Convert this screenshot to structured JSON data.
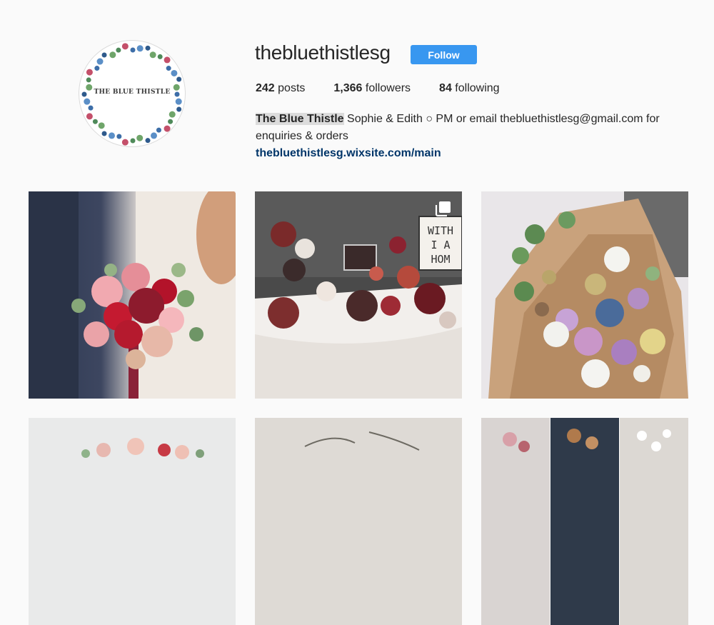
{
  "profile": {
    "username": "thebluethistlesg",
    "follow_label": "Follow",
    "avatar_text": "THE BLUE THISTLE",
    "stats": {
      "posts_count": "242",
      "posts_label": "posts",
      "followers_count": "1,366",
      "followers_label": "followers",
      "following_count": "84",
      "following_label": "following"
    },
    "bio": {
      "name": "The Blue Thistle",
      "text": " Sophie & Edith ○ PM or email thebluethistlesg@gmail.com for enquiries & orders",
      "link": "thebluethistlesg.wixsite.com/main"
    }
  },
  "colors": {
    "follow_button": "#3897f0",
    "link": "#003569",
    "background": "#fafafa"
  },
  "grid": {
    "posts": [
      {
        "subject": "bridal-bouquet",
        "icon": "photo-icon"
      },
      {
        "subject": "flower-table-display",
        "icon": "multiple-photos-icon"
      },
      {
        "subject": "thistle-bouquet",
        "icon": "photo-icon"
      },
      {
        "subject": "bouquet-partial",
        "icon": "photo-icon"
      },
      {
        "subject": "flowers-partial",
        "icon": "photo-icon"
      },
      {
        "subject": "collage-partial",
        "icon": "photo-icon"
      }
    ]
  }
}
